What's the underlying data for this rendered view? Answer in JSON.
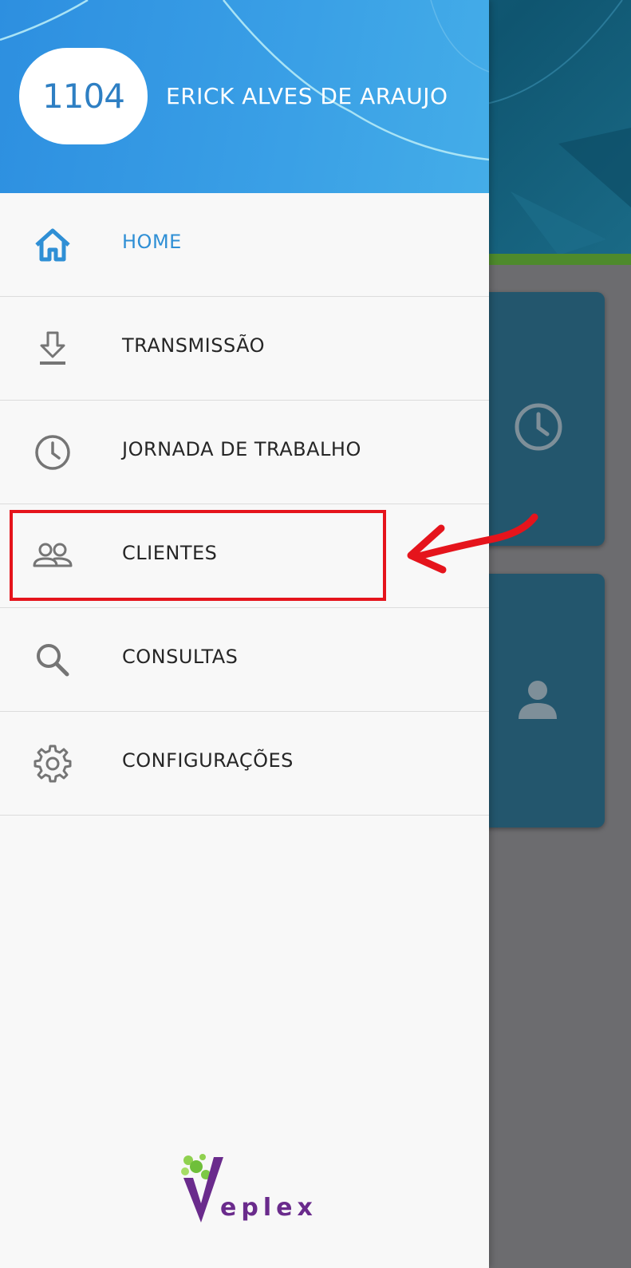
{
  "user": {
    "code": "1104",
    "name": "ERICK ALVES DE ARAUJO"
  },
  "menu": {
    "items": [
      {
        "label": "HOME",
        "icon": "home-icon",
        "active": true
      },
      {
        "label": "TRANSMISSÃO",
        "icon": "download-icon"
      },
      {
        "label": "JORNADA DE TRABALHO",
        "icon": "clock-icon"
      },
      {
        "label": "CLIENTES",
        "icon": "people-icon"
      },
      {
        "label": "CONSULTAS",
        "icon": "search-icon"
      },
      {
        "label": "CONFIGURAÇÕES",
        "icon": "gear-icon"
      }
    ]
  },
  "branding": {
    "logo_text": "eplex",
    "logo_letter": "V"
  },
  "annotation": {
    "highlighted_item": "CLIENTES",
    "highlight_color": "#e5141c"
  },
  "colors": {
    "header_blue": "#3aa0e6",
    "active_blue": "#2f8fd5",
    "brand_purple": "#6a2b8c",
    "brand_green": "#8fd14f"
  }
}
